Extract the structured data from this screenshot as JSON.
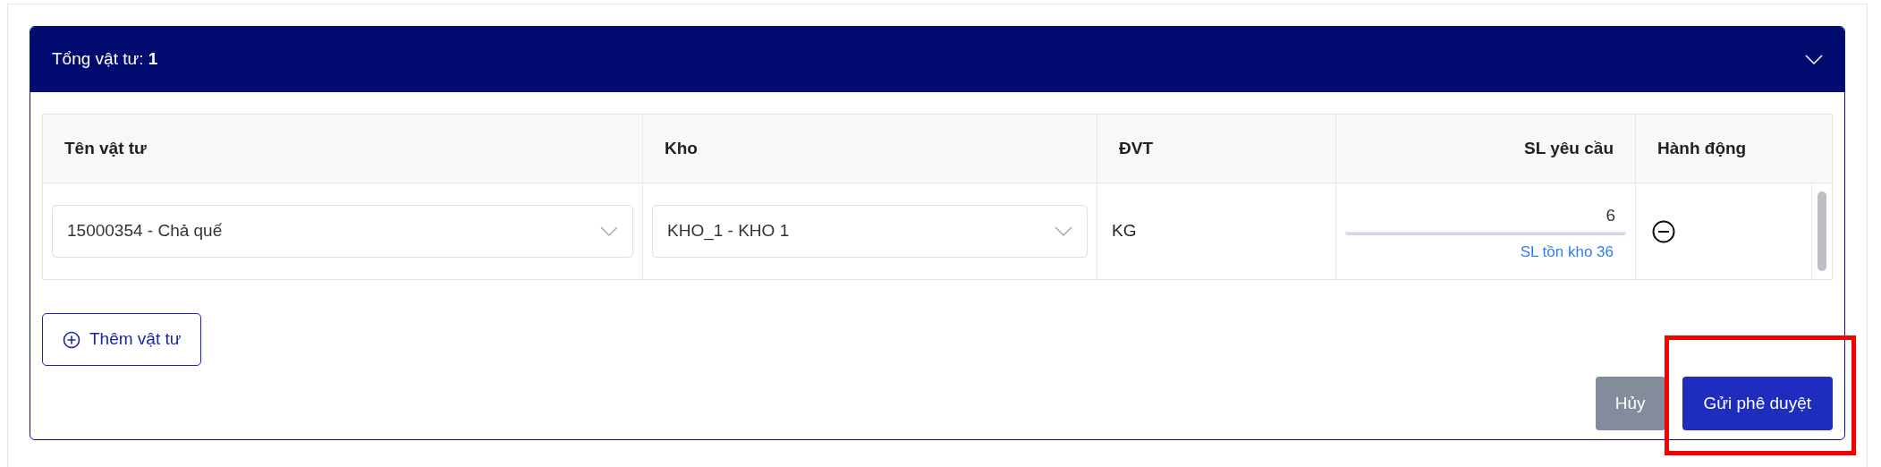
{
  "panel": {
    "title": "Tổng vật tư: ",
    "count": "1",
    "expanded": true
  },
  "table": {
    "columns": [
      "Tên vật tư",
      "Kho",
      "ĐVT",
      "SL yêu cầu",
      "Hành động"
    ],
    "rows": [
      {
        "material": "15000354 - Chả quế",
        "warehouse": "KHO_1 - KHO 1",
        "unit": "KG",
        "quantity": "6",
        "stock_note": "SL tồn kho 36"
      }
    ]
  },
  "add_button": "Thêm vật tư",
  "buttons": [
    {
      "label": "Hủy",
      "kind": "secondary",
      "highlighted": false
    },
    {
      "label": "Gửi phê duyệt",
      "kind": "primary",
      "highlighted": true
    }
  ]
}
